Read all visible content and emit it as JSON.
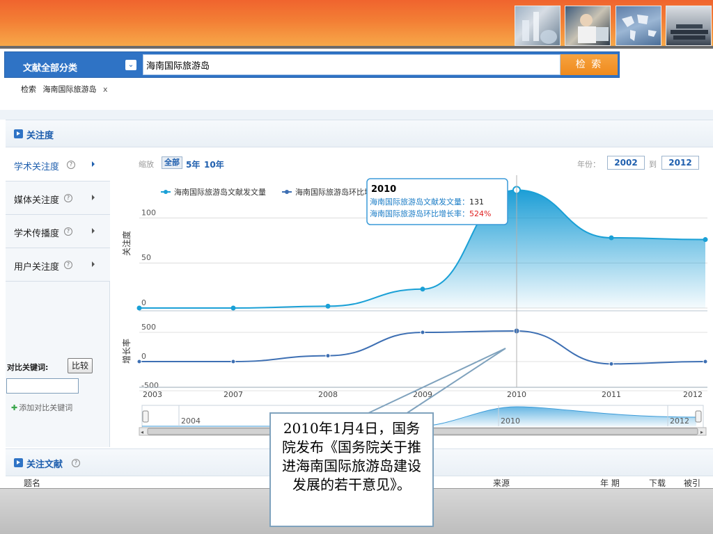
{
  "search": {
    "category_label": "文献全部分类",
    "query": "海南国际旅游岛",
    "button_label": "检 索"
  },
  "breadcrumb": {
    "label": "检索",
    "term": "海南国际旅游岛",
    "close": "x"
  },
  "sections": {
    "attention": "关注度",
    "docs": "关注文献"
  },
  "sidebar": {
    "items": [
      {
        "label": "学术关注度",
        "active": true
      },
      {
        "label": "媒体关注度",
        "active": false
      },
      {
        "label": "学术传播度",
        "active": false
      },
      {
        "label": "用户关注度",
        "active": false
      }
    ],
    "help_glyph": "?",
    "compare_label": "对比关键词:",
    "compare_button": "比较",
    "add_keyword": "添加对比关键词"
  },
  "toolbar": {
    "zoom_label": "缩放",
    "zoom_all": "全部",
    "zoom_5": "5年",
    "zoom_10": "10年",
    "year_label": "年份：",
    "year_from": "2002",
    "year_to_label": "到",
    "year_to": "2012"
  },
  "chart_data": {
    "type": "area",
    "x": [
      2003,
      2007,
      2008,
      2009,
      2010,
      2011,
      2012
    ],
    "x_ticks": [
      "2003",
      "2007",
      "2008",
      "2009",
      "2010",
      "2011",
      "2012"
    ],
    "top_panel": {
      "ylabel": "关注度",
      "y_ticks": [
        "0",
        "50",
        "100"
      ],
      "ylim": [
        0,
        130
      ],
      "series": [
        {
          "name": "海南国际旅游岛文献发文量",
          "x": [
            2003,
            2007,
            2008,
            2009,
            2010,
            2011,
            2012
          ],
          "values": [
            0,
            0,
            2,
            21,
            131,
            78,
            76
          ],
          "color": "#1aa0d6"
        }
      ]
    },
    "bottom_panel": {
      "ylabel": "增长率",
      "y_ticks": [
        "500",
        "0",
        "-500"
      ],
      "ylim": [
        -500,
        500
      ],
      "series": [
        {
          "name": "海南国际旅游岛环比增长率",
          "x": [
            2003,
            2007,
            2008,
            2009,
            2010,
            2011,
            2012
          ],
          "values": [
            0,
            0,
            100,
            500,
            524,
            -40,
            0
          ],
          "color": "#3d6fb3"
        }
      ]
    },
    "legend": [
      "海南国际旅游岛文献发文量",
      "海南国际旅游岛环比增长率"
    ],
    "legend_placement": "top-left",
    "tooltip": {
      "year": "2010",
      "line1_label": "海南国际旅游岛文献发文量：",
      "line1_value": "131",
      "line2_label": "海南国际旅游岛环比增长率：",
      "line2_value": "524%"
    },
    "navigator_labels": [
      "2004",
      "2010",
      "2012"
    ],
    "grid": true
  },
  "doc_columns": [
    "题名",
    "来源",
    "年 期",
    "下载",
    "被引"
  ],
  "callout": "2010年1月4日，国务院发布《国务院关于推进海南国际旅游岛建设发展的若干意见》。"
}
